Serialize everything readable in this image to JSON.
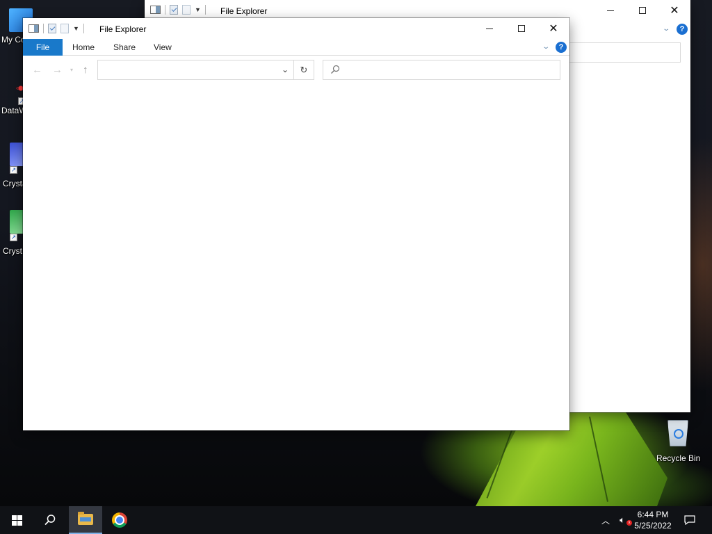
{
  "desktop": {
    "icons": [
      {
        "label": "My Co"
      },
      {
        "label": "DataW"
      },
      {
        "label": "Crysta"
      },
      {
        "label": "Cryst"
      },
      {
        "label": "Recycle Bin"
      }
    ]
  },
  "back_window": {
    "title": "File Explorer"
  },
  "front_window": {
    "title": "File Explorer",
    "ribbon_tabs": {
      "file": "File",
      "home": "Home",
      "share": "Share",
      "view": "View"
    },
    "help_label": "?",
    "address_value": "",
    "search_placeholder": ""
  },
  "taskbar": {
    "clock_time": "6:44 PM",
    "clock_date": "5/25/2022",
    "pinned": [
      "start-icon",
      "search-icon",
      "file-explorer-icon",
      "chrome-icon"
    ],
    "tray_icons": [
      "chevron-up-icon",
      "speaker-muted-icon",
      "notification-icon"
    ]
  },
  "colors": {
    "accent": "#1979ca",
    "help": "#1a6fd1",
    "taskbar": "#101216",
    "wallpaper_green": "#9fd12a"
  }
}
